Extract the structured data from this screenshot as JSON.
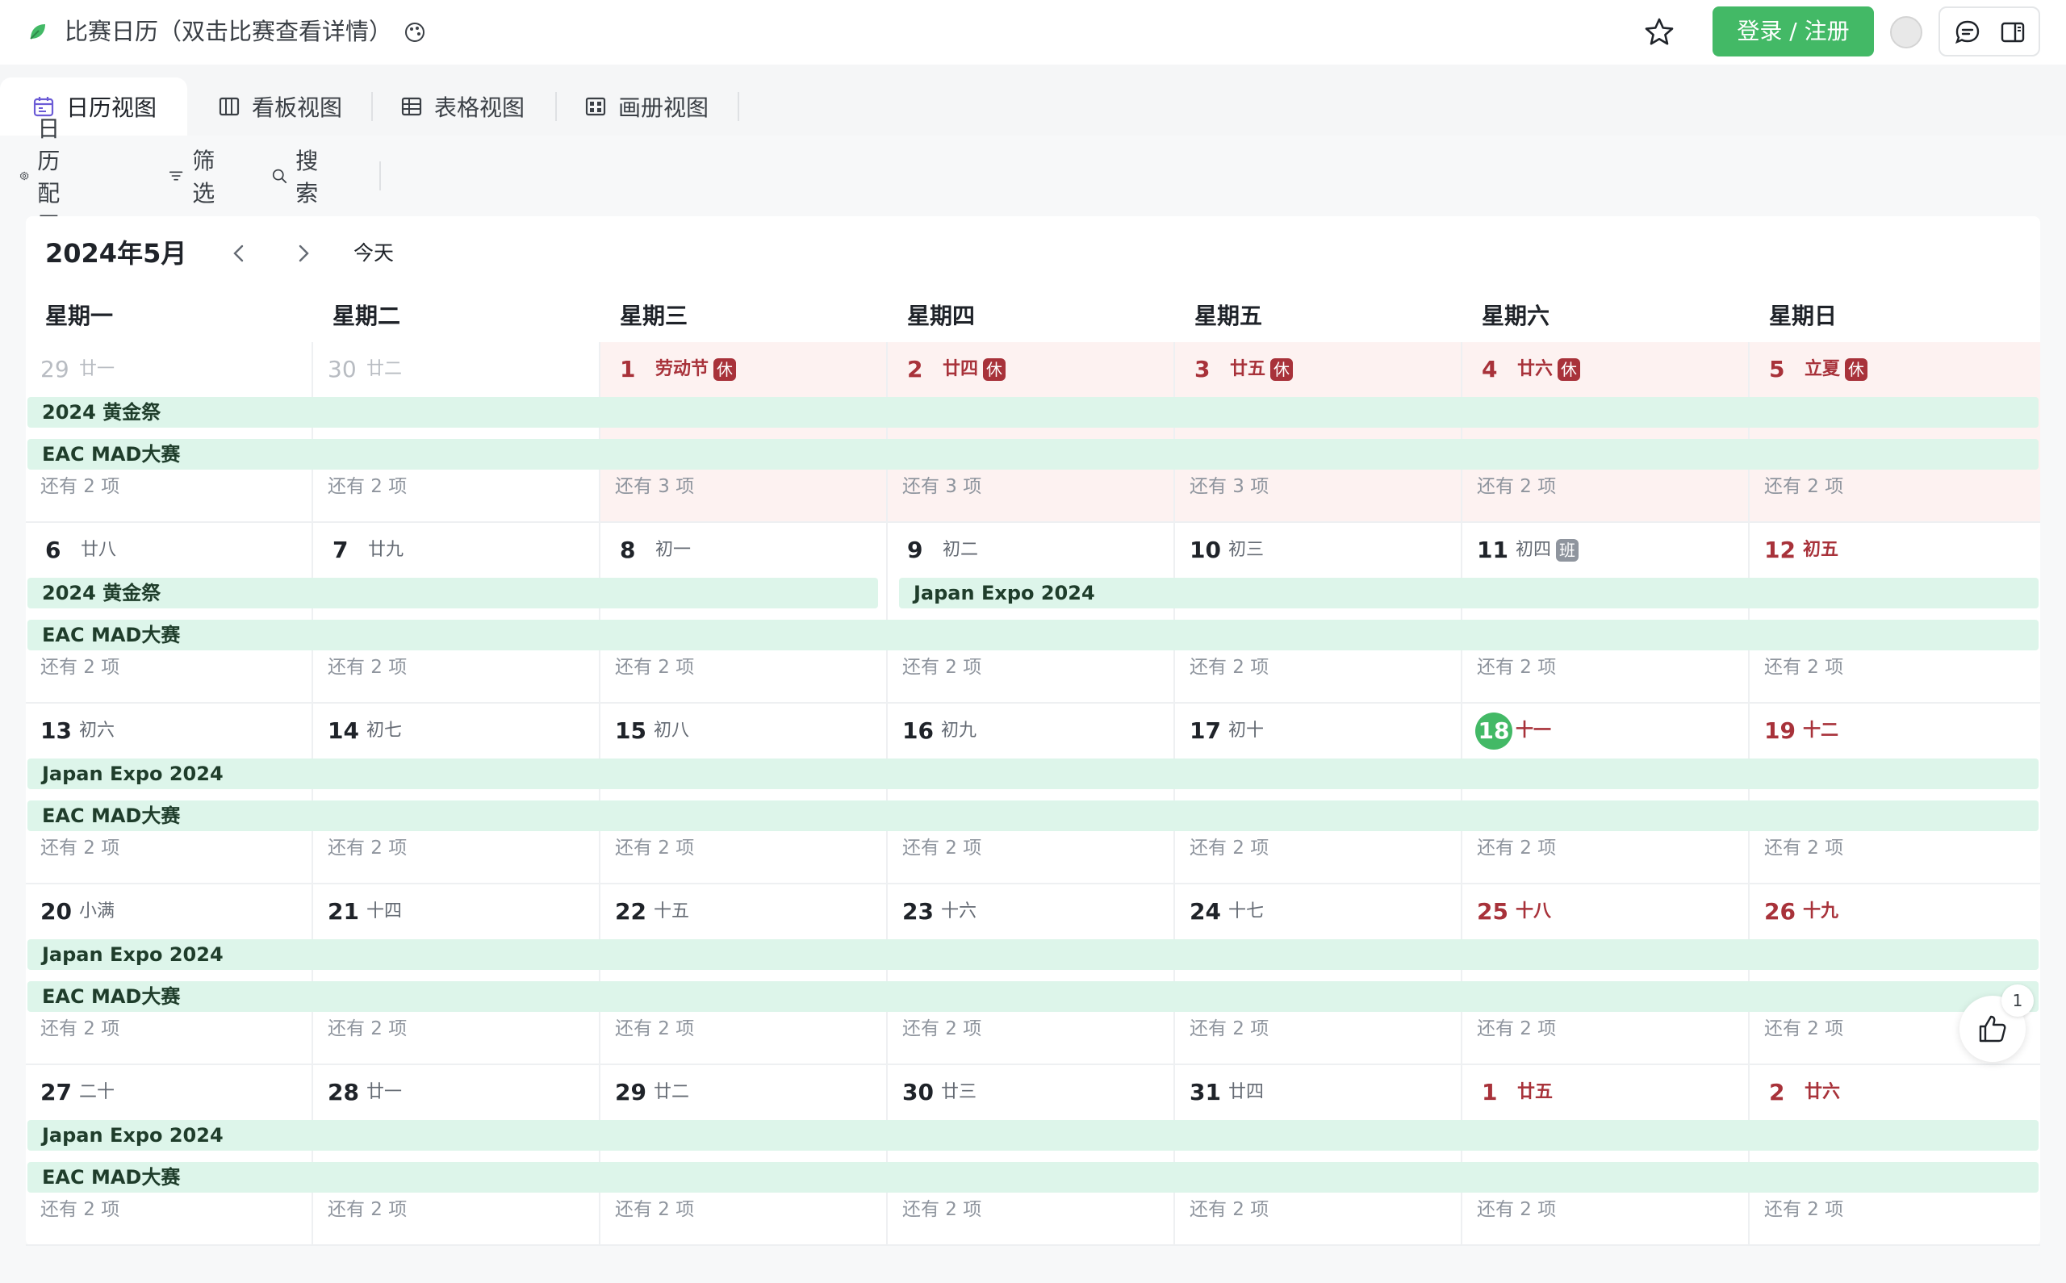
{
  "app": {
    "title": "比赛日历（双击比赛查看详情）",
    "login_label": "登录 / 注册",
    "accent_color": "#43b966"
  },
  "tabs": [
    {
      "label": "日历视图",
      "icon": "calendar-icon",
      "active": true
    },
    {
      "label": "看板视图",
      "icon": "kanban-icon",
      "active": false
    },
    {
      "label": "表格视图",
      "icon": "table-icon",
      "active": false
    },
    {
      "label": "画册视图",
      "icon": "gallery-icon",
      "active": false
    }
  ],
  "toolbar": {
    "config_label": "日历配置",
    "filter_label": "筛选",
    "search_label": "搜索"
  },
  "calendar": {
    "month_label": "2024年5月",
    "today_label": "今天",
    "weekdays": [
      "星期一",
      "星期二",
      "星期三",
      "星期四",
      "星期五",
      "星期六",
      "星期日"
    ],
    "weeks": [
      {
        "days": [
          {
            "num": "29",
            "lunar": "廿一",
            "more": "还有 2 项"
          },
          {
            "num": "30",
            "lunar": "廿二",
            "more": "还有 2 项"
          },
          {
            "num": "1",
            "lunar": "劳动节",
            "badge": "休",
            "more": "还有 3 项"
          },
          {
            "num": "2",
            "lunar": "廿四",
            "badge": "休",
            "more": "还有 3 项"
          },
          {
            "num": "3",
            "lunar": "廿五",
            "badge": "休",
            "more": "还有 3 项"
          },
          {
            "num": "4",
            "lunar": "廿六",
            "badge": "休",
            "more": "还有 2 项"
          },
          {
            "num": "5",
            "lunar": "立夏",
            "badge": "休",
            "more": "还有 2 项"
          }
        ],
        "events": [
          "2024 黄金祭",
          "EAC MAD大赛"
        ]
      },
      {
        "days": [
          {
            "num": "6",
            "lunar": "廿八",
            "more": "还有 2 项"
          },
          {
            "num": "7",
            "lunar": "廿九",
            "more": "还有 2 项"
          },
          {
            "num": "8",
            "lunar": "初一",
            "more": "还有 2 项"
          },
          {
            "num": "9",
            "lunar": "初二",
            "more": "还有 2 项"
          },
          {
            "num": "10",
            "lunar": "初三",
            "more": "还有 2 项"
          },
          {
            "num": "11",
            "lunar": "初四",
            "badge": "班",
            "more": "还有 2 项"
          },
          {
            "num": "12",
            "lunar": "初五",
            "more": "还有 2 项"
          }
        ],
        "events": [
          "2024 黄金祭",
          "Japan Expo 2024",
          "EAC MAD大赛"
        ]
      },
      {
        "days": [
          {
            "num": "13",
            "lunar": "初六",
            "more": "还有 2 项"
          },
          {
            "num": "14",
            "lunar": "初七",
            "more": "还有 2 项"
          },
          {
            "num": "15",
            "lunar": "初八",
            "more": "还有 2 项"
          },
          {
            "num": "16",
            "lunar": "初九",
            "more": "还有 2 项"
          },
          {
            "num": "17",
            "lunar": "初十",
            "more": "还有 2 项"
          },
          {
            "num": "18",
            "lunar": "十一",
            "more": "还有 2 项"
          },
          {
            "num": "19",
            "lunar": "十二",
            "more": "还有 2 项"
          }
        ],
        "events": [
          "Japan Expo 2024",
          "EAC MAD大赛"
        ]
      },
      {
        "days": [
          {
            "num": "20",
            "lunar": "小满",
            "more": "还有 2 项"
          },
          {
            "num": "21",
            "lunar": "十四",
            "more": "还有 2 项"
          },
          {
            "num": "22",
            "lunar": "十五",
            "more": "还有 2 项"
          },
          {
            "num": "23",
            "lunar": "十六",
            "more": "还有 2 项"
          },
          {
            "num": "24",
            "lunar": "十七",
            "more": "还有 2 项"
          },
          {
            "num": "25",
            "lunar": "十八",
            "more": "还有 2 项"
          },
          {
            "num": "26",
            "lunar": "十九",
            "more": "还有 2 项"
          }
        ],
        "events": [
          "Japan Expo 2024",
          "EAC MAD大赛"
        ]
      },
      {
        "days": [
          {
            "num": "27",
            "lunar": "二十",
            "more": "还有 2 项"
          },
          {
            "num": "28",
            "lunar": "廿一",
            "more": "还有 2 项"
          },
          {
            "num": "29",
            "lunar": "廿二",
            "more": "还有 2 项"
          },
          {
            "num": "30",
            "lunar": "廿三",
            "more": "还有 2 项"
          },
          {
            "num": "31",
            "lunar": "廿四",
            "more": "还有 2 项"
          },
          {
            "num": "1",
            "lunar": "廿五",
            "more": "还有 2 项"
          },
          {
            "num": "2",
            "lunar": "廿六",
            "more": "还有 2 项"
          }
        ],
        "events": [
          "Japan Expo 2024",
          "EAC MAD大赛"
        ]
      }
    ]
  },
  "like": {
    "count": "1"
  }
}
